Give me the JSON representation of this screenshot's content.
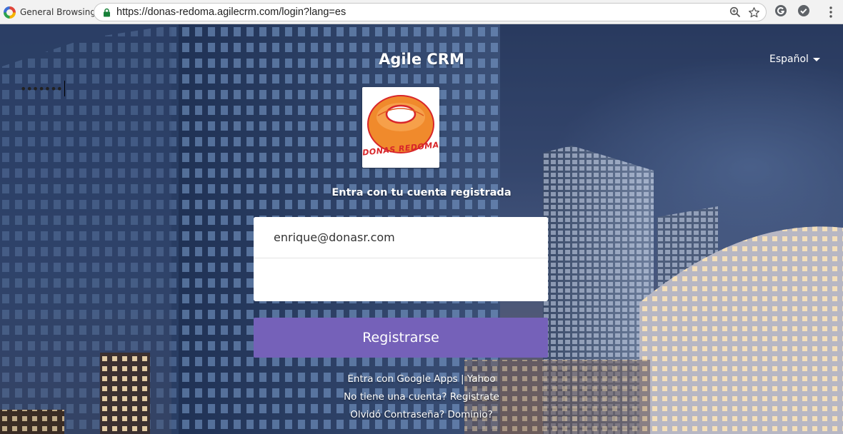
{
  "browser": {
    "profile_name": "General Browsing",
    "url": "https://donas-redoma.agilecrm.com/login?lang=es",
    "icons": [
      "lock-icon",
      "zoom-icon",
      "bookmark-star-icon",
      "extension-grammarly-icon",
      "extension-check-icon",
      "menu-dots-icon"
    ]
  },
  "page": {
    "brand_title": "Agile CRM",
    "language": "Español",
    "logo_text": "DONAS REDOMA",
    "subtitle": "Entra con tu cuenta registrada",
    "email_value": "enrique@donasr.com",
    "password_mask": "•••••••",
    "submit_label": "Registrarse",
    "links": {
      "google_apps": "Entra con Google Apps",
      "separator": "|",
      "yahoo": "Yahoo",
      "no_account": "No tiene una cuenta?",
      "register": "Registrate",
      "forgot_password": "Olvidó Contraseña?",
      "domain": "Dominio?"
    }
  },
  "colors": {
    "button": "#7561b9",
    "donut_orange": "#f08a2c",
    "donut_red": "#d8262a"
  }
}
